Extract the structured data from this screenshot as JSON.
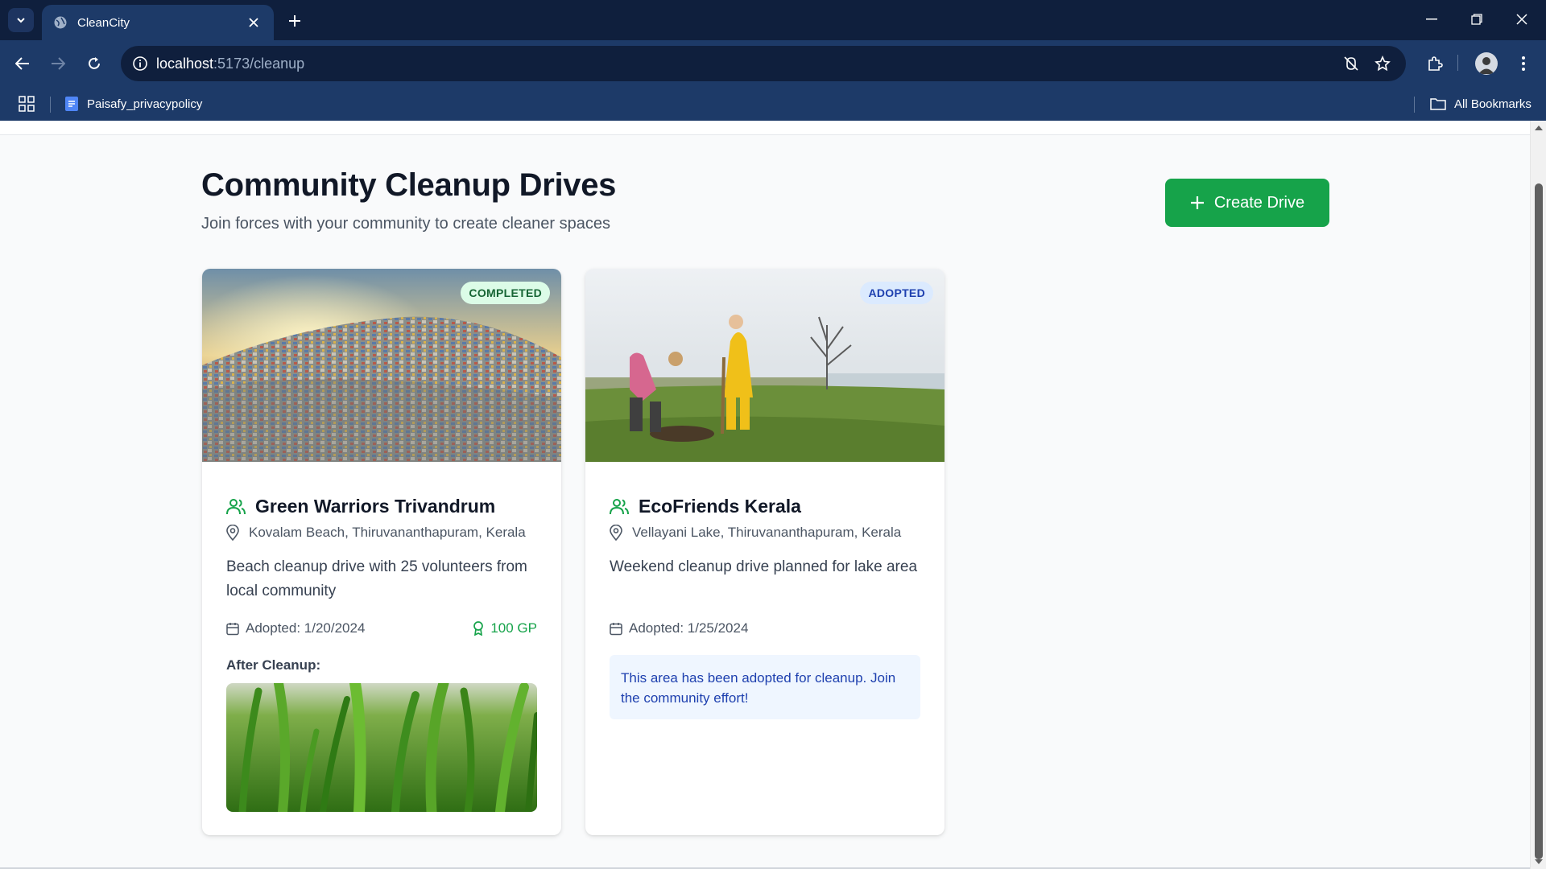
{
  "browser": {
    "tab_title": "CleanCity",
    "url_host": "localhost",
    "url_path": ":5173/cleanup",
    "bookmark_label": "Paisafy_privacypolicy",
    "all_bookmarks_label": "All Bookmarks"
  },
  "page": {
    "title": "Community Cleanup Drives",
    "subtitle": "Join forces with your community to create cleaner spaces",
    "create_button_label": "Create Drive"
  },
  "drives": [
    {
      "status": "COMPLETED",
      "name": "Green Warriors Trivandrum",
      "location": "Kovalam Beach, Thiruvananthapuram, Kerala",
      "description": "Beach cleanup drive with 25 volunteers from local community",
      "adopted": "Adopted: 1/20/2024",
      "points": "100 GP",
      "after_label": "After Cleanup:"
    },
    {
      "status": "ADOPTED",
      "name": "EcoFriends Kerala",
      "location": "Vellayani Lake, Thiruvananthapuram, Kerala",
      "description": "Weekend cleanup drive planned for lake area",
      "adopted": "Adopted: 1/25/2024",
      "notice": "This area has been adopted for cleanup. Join the community effort!"
    }
  ],
  "colors": {
    "brand_green": "#16a34a",
    "chrome_dark": "#0f1f3d",
    "chrome_mid": "#1d3a68",
    "notice_bg": "#eff6ff",
    "notice_text": "#1e40af"
  },
  "icons": {
    "tab_search": "chevron-down-icon",
    "favicon": "globe-icon",
    "group": "users-icon",
    "location": "map-pin-icon",
    "date": "calendar-icon",
    "points": "award-icon"
  }
}
